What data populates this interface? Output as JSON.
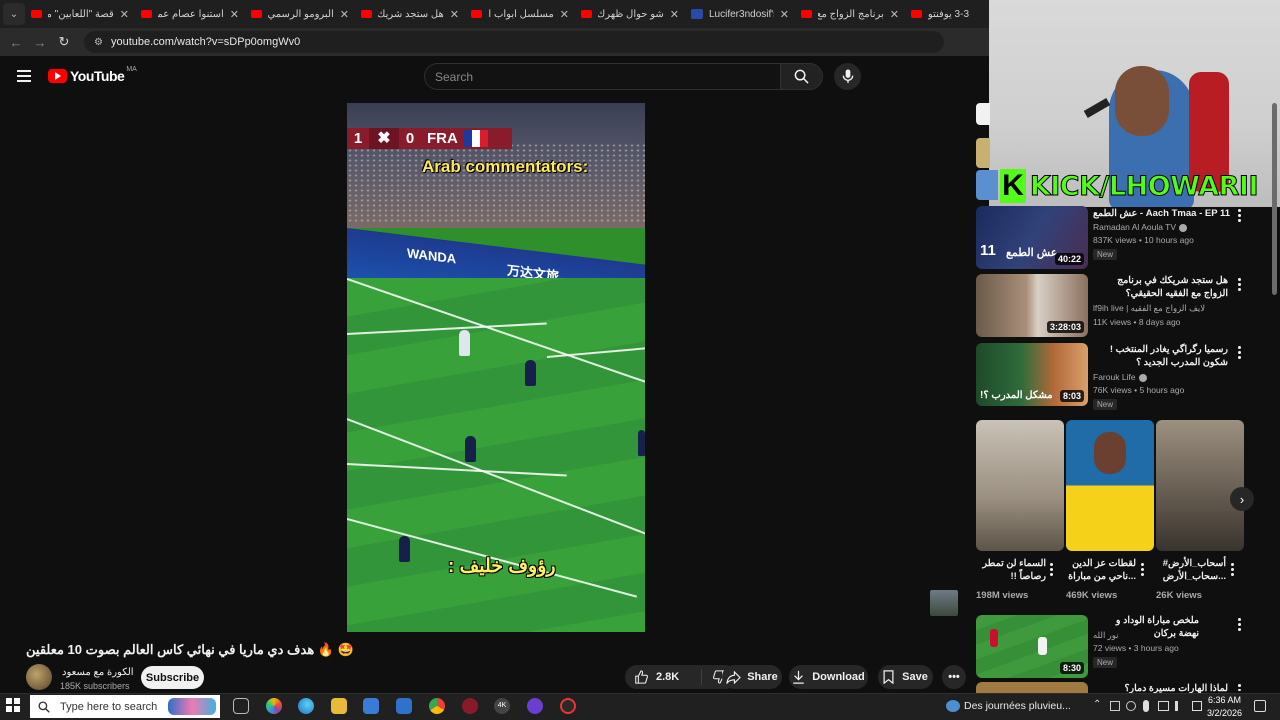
{
  "browser": {
    "tabs": [
      {
        "title": "قصة \"اللعابين\" مت",
        "favicon": "youtube-icon"
      },
      {
        "title": "استنوا عصام عمر",
        "favicon": "youtube-icon"
      },
      {
        "title": "البرومو الرسمي لـ",
        "favicon": "youtube-icon"
      },
      {
        "title": "هل ستجد شريك حـ",
        "favicon": "youtube-icon"
      },
      {
        "title": "مسلسل أبواب الخـ",
        "favicon": "youtube-icon"
      },
      {
        "title": "شو حوال ظهرك يا",
        "favicon": "youtube-icon"
      },
      {
        "title": "Lucifer3ndosif's",
        "favicon": "site-icon"
      },
      {
        "title": "برنامج الزواج مع ال",
        "favicon": "youtube-icon"
      },
      {
        "title": "3-3 يوفنتوس",
        "favicon": "youtube-icon"
      }
    ],
    "url": "youtube.com/watch?v=sDPp0omgWv0"
  },
  "header": {
    "logo_text": "YouTube",
    "country_code": "MA",
    "search_placeholder": "Search"
  },
  "video": {
    "scoreboard": {
      "home_score": "1",
      "away_score": "0",
      "away_team": "FRA"
    },
    "caption_top": "Arab commentators:",
    "caption_bottom": "رؤوف خليف :",
    "ad_boards": [
      "WANDA",
      "万达文旅",
      "WA"
    ],
    "title": "🤩 🔥 هدف دي ماريا في نهائي كاس العالم بصوت 10 معلقين",
    "channel": "الكورة مع مسعود",
    "subscribers": "185K subscribers",
    "subscribe_label": "Subscribe",
    "likes": "2.8K",
    "share_label": "Share",
    "download_label": "Download",
    "save_label": "Save"
  },
  "overlay": {
    "kick_handle": "KICK/LHOWARII",
    "kick_logo_letter": "K"
  },
  "recommended": [
    {
      "title": "عش الطمع - Aach Tmaa - EP 11",
      "channel": "Ramadan Al Aoula TV",
      "verified": true,
      "views": "837K views",
      "age": "10 hours ago",
      "badge": "New",
      "duration": "40:22",
      "thumb_text": "عش الطمع"
    },
    {
      "title": "هل ستجد شريكك في برنامج الزواج مع الفقيه الحقيقي؟",
      "channel": "lf9ih live | لايف الزواج مع الفقيه",
      "verified": false,
      "views": "11K views",
      "age": "8 days ago",
      "badge": "",
      "duration": "3:28:03",
      "thumb_text": ""
    },
    {
      "title": "رسميا رگراگي يغادر المنتخب ! شكون المدرب الجديد ؟",
      "channel": "Farouk Life",
      "verified": true,
      "views": "76K views",
      "age": "5 hours ago",
      "badge": "New",
      "duration": "8:03",
      "thumb_text": "مشكل المدرب ؟!"
    },
    {
      "title": "ملخص مباراة الوداد و نهضة بركان",
      "channel": "نور الله",
      "verified": false,
      "views": "72 views",
      "age": "3 hours ago",
      "badge": "New",
      "duration": "8:30",
      "thumb_text": ""
    }
  ],
  "shorts": [
    {
      "title": "السماء لن تمطر رصاصاً !!",
      "views": "198M views"
    },
    {
      "title": "لقطات عز الدين ...ناحي من مباراة",
      "views": "469K views"
    },
    {
      "title": "أسحاب_الأرض# ...سحاب_الأرض",
      "views": "26K views"
    }
  ],
  "partial_next_title": "لماذا الهارات مسيرة دمار؟",
  "taskbar": {
    "search_placeholder": "Type here to search",
    "weather": "Des journées pluvieu...",
    "time": "6:36 AM",
    "date": "3/2/2026"
  },
  "colors": {
    "background": "#0f0f0f",
    "youtube_red": "#ff0000",
    "kick_green": "#53fc18",
    "pill": "#272727"
  }
}
